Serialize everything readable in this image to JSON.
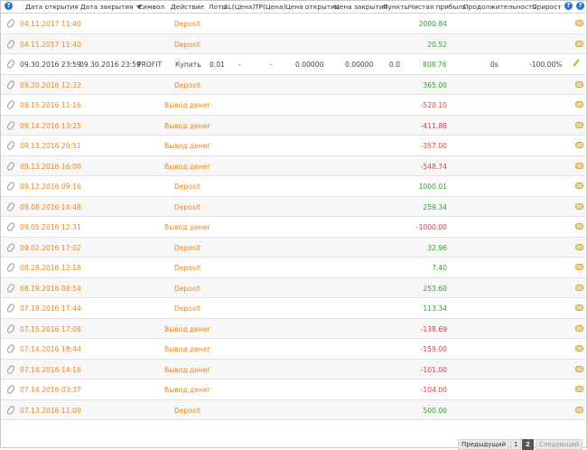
{
  "header": {
    "open_date": "Дата открытия",
    "close_date": "Дата закрытия",
    "symbol": "Символ",
    "action": "Действие",
    "lots": "Лоты",
    "sl": "SL(Цена)",
    "tp": "TP(Цена)",
    "open_price": "Цена открытия",
    "close_price": "Цена закрытия",
    "pips": "Пункты",
    "profit": "Чистая прибыль",
    "duration": "Продолжительность",
    "gain": "Прирост"
  },
  "rows": [
    {
      "date": "04.11.2017 11:40",
      "action": "Deposit",
      "profit": "2000.84",
      "sign": "pos"
    },
    {
      "date": "04.11.2017 11:40",
      "action": "Deposit",
      "profit": "20.52",
      "sign": "pos"
    },
    {
      "open_date": "09.30.2016 23:59",
      "close_date": "09.30.2016 23:59",
      "symbol": "PROFIT",
      "action": "Купить",
      "lots": "0.01",
      "sl": "-",
      "tp": "-",
      "open_price": "0.00000",
      "close_price": "0.00000",
      "pips": "0.0",
      "profit": "808.76",
      "duration": "0s",
      "gain": "-100.00%",
      "sign": "pos",
      "trade": true
    },
    {
      "date": "09.20.2016 12:32",
      "action": "Deposit",
      "profit": "365.00",
      "sign": "pos"
    },
    {
      "date": "09.15.2016 11:16",
      "action": "Вывод денег",
      "profit": "-520.10",
      "sign": "neg"
    },
    {
      "date": "09.14.2016 13:25",
      "action": "Вывод денег",
      "profit": "-411.88",
      "sign": "neg"
    },
    {
      "date": "09.13.2016 20:51",
      "action": "Вывод денег",
      "profit": "-357.00",
      "sign": "neg"
    },
    {
      "date": "09.13.2016 16:00",
      "action": "Вывод денег",
      "profit": "-548.74",
      "sign": "neg"
    },
    {
      "date": "09.12.2016 09:16",
      "action": "Deposit",
      "profit": "1000.01",
      "sign": "pos"
    },
    {
      "date": "09.08.2016 14:48",
      "action": "Deposit",
      "profit": "259.34",
      "sign": "pos"
    },
    {
      "date": "09.05.2016 12:31",
      "action": "Вывод денег",
      "profit": "-1000.00",
      "sign": "neg"
    },
    {
      "date": "09.02.2016 17:02",
      "action": "Deposit",
      "profit": "32.96",
      "sign": "pos"
    },
    {
      "date": "08.28.2016 12:18",
      "action": "Deposit",
      "profit": "7.40",
      "sign": "pos"
    },
    {
      "date": "08.19.2016 08:54",
      "action": "Deposit",
      "profit": "253.60",
      "sign": "pos"
    },
    {
      "date": "07.19.2016 17:44",
      "action": "Deposit",
      "profit": "113.34",
      "sign": "pos"
    },
    {
      "date": "07.15.2016 17:08",
      "action": "Вывод денег",
      "profit": "-138.69",
      "sign": "neg"
    },
    {
      "date": "07.14.2016 18:44",
      "action": "Вывод денег",
      "profit": "-159.00",
      "sign": "neg"
    },
    {
      "date": "07.14.2016 14:16",
      "action": "Вывод денег",
      "profit": "-101.00",
      "sign": "neg"
    },
    {
      "date": "07.14.2016 03:37",
      "action": "Вывод денег",
      "profit": "-104.00",
      "sign": "neg"
    },
    {
      "date": "07.13.2016 11:09",
      "action": "Deposit",
      "profit": "500.00",
      "sign": "pos"
    }
  ],
  "pager": {
    "prev": "Предыдущий",
    "page1": "1",
    "page2": "2",
    "next": "Следующий"
  },
  "colors": {
    "accent_orange": "#e8871e",
    "positive": "#2ca02c",
    "negative": "#e03a3a",
    "help_icon": "#2f6fd0"
  }
}
